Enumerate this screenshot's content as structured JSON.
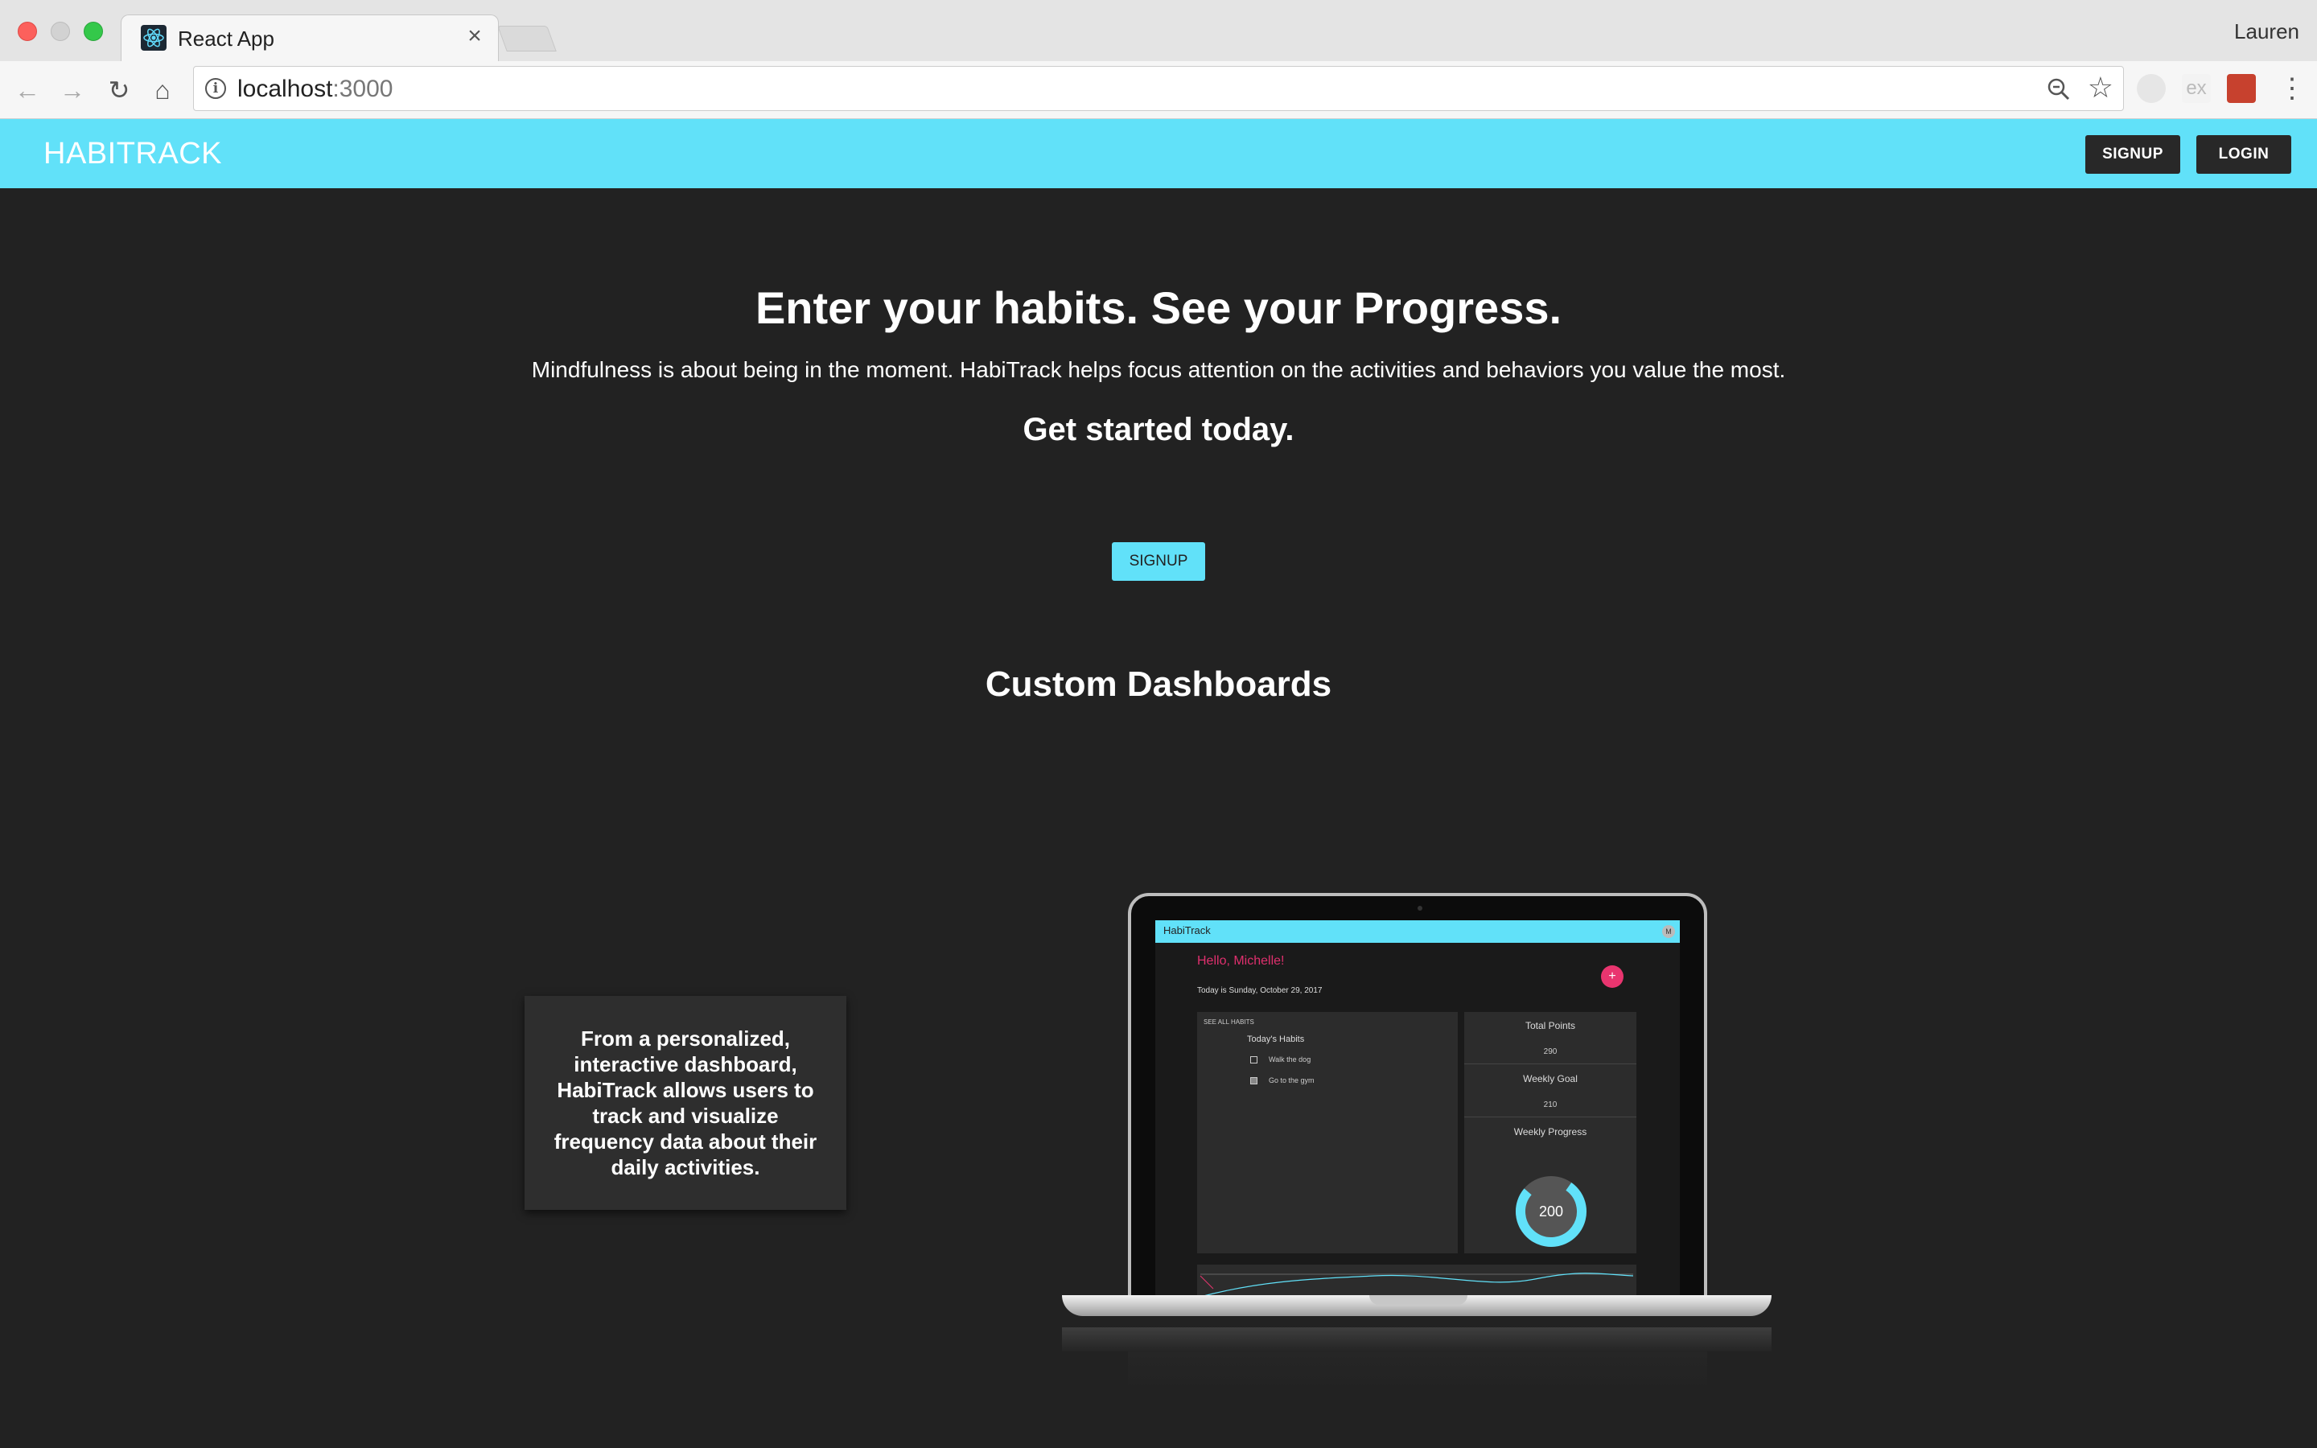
{
  "browser": {
    "tab_title": "React App",
    "tab_close": "×",
    "profile_name": "Lauren",
    "url_host": "localhost",
    "url_port": ":3000",
    "extension_label": "ex"
  },
  "header": {
    "brand": "HABITRACK",
    "signup_label": "SIGNUP",
    "login_label": "LOGIN",
    "accent_color": "#61e1f9"
  },
  "hero": {
    "title": "Enter your habits. See your Progress.",
    "subtitle": "Mindfulness is about being in the moment. HabiTrack helps focus attention on the activities and behaviors you value the most.",
    "cta_text": "Get started today.",
    "signup_label": "SIGNUP"
  },
  "section": {
    "title": "Custom Dashboards"
  },
  "feature": {
    "text": "From a personalized, interactive dashboard, HabiTrack allows users to track and visualize frequency data about their daily activities."
  },
  "mockup": {
    "brand": "HabiTrack",
    "avatar": "M",
    "greeting": "Hello, Michelle!",
    "date_text": "Today is Sunday, October 29, 2017",
    "fab": "+",
    "see_all": "SEE ALL HABITS",
    "habits_title": "Today's Habits",
    "habits": [
      {
        "label": "Walk the dog",
        "checked": false
      },
      {
        "label": "Go to the gym",
        "checked": true
      }
    ],
    "total_points_label": "Total Points",
    "total_points": "290",
    "weekly_goal_label": "Weekly Goal",
    "weekly_goal": "210",
    "weekly_progress_label": "Weekly Progress",
    "weekly_progress": "200",
    "progress_fraction": 0.95
  }
}
